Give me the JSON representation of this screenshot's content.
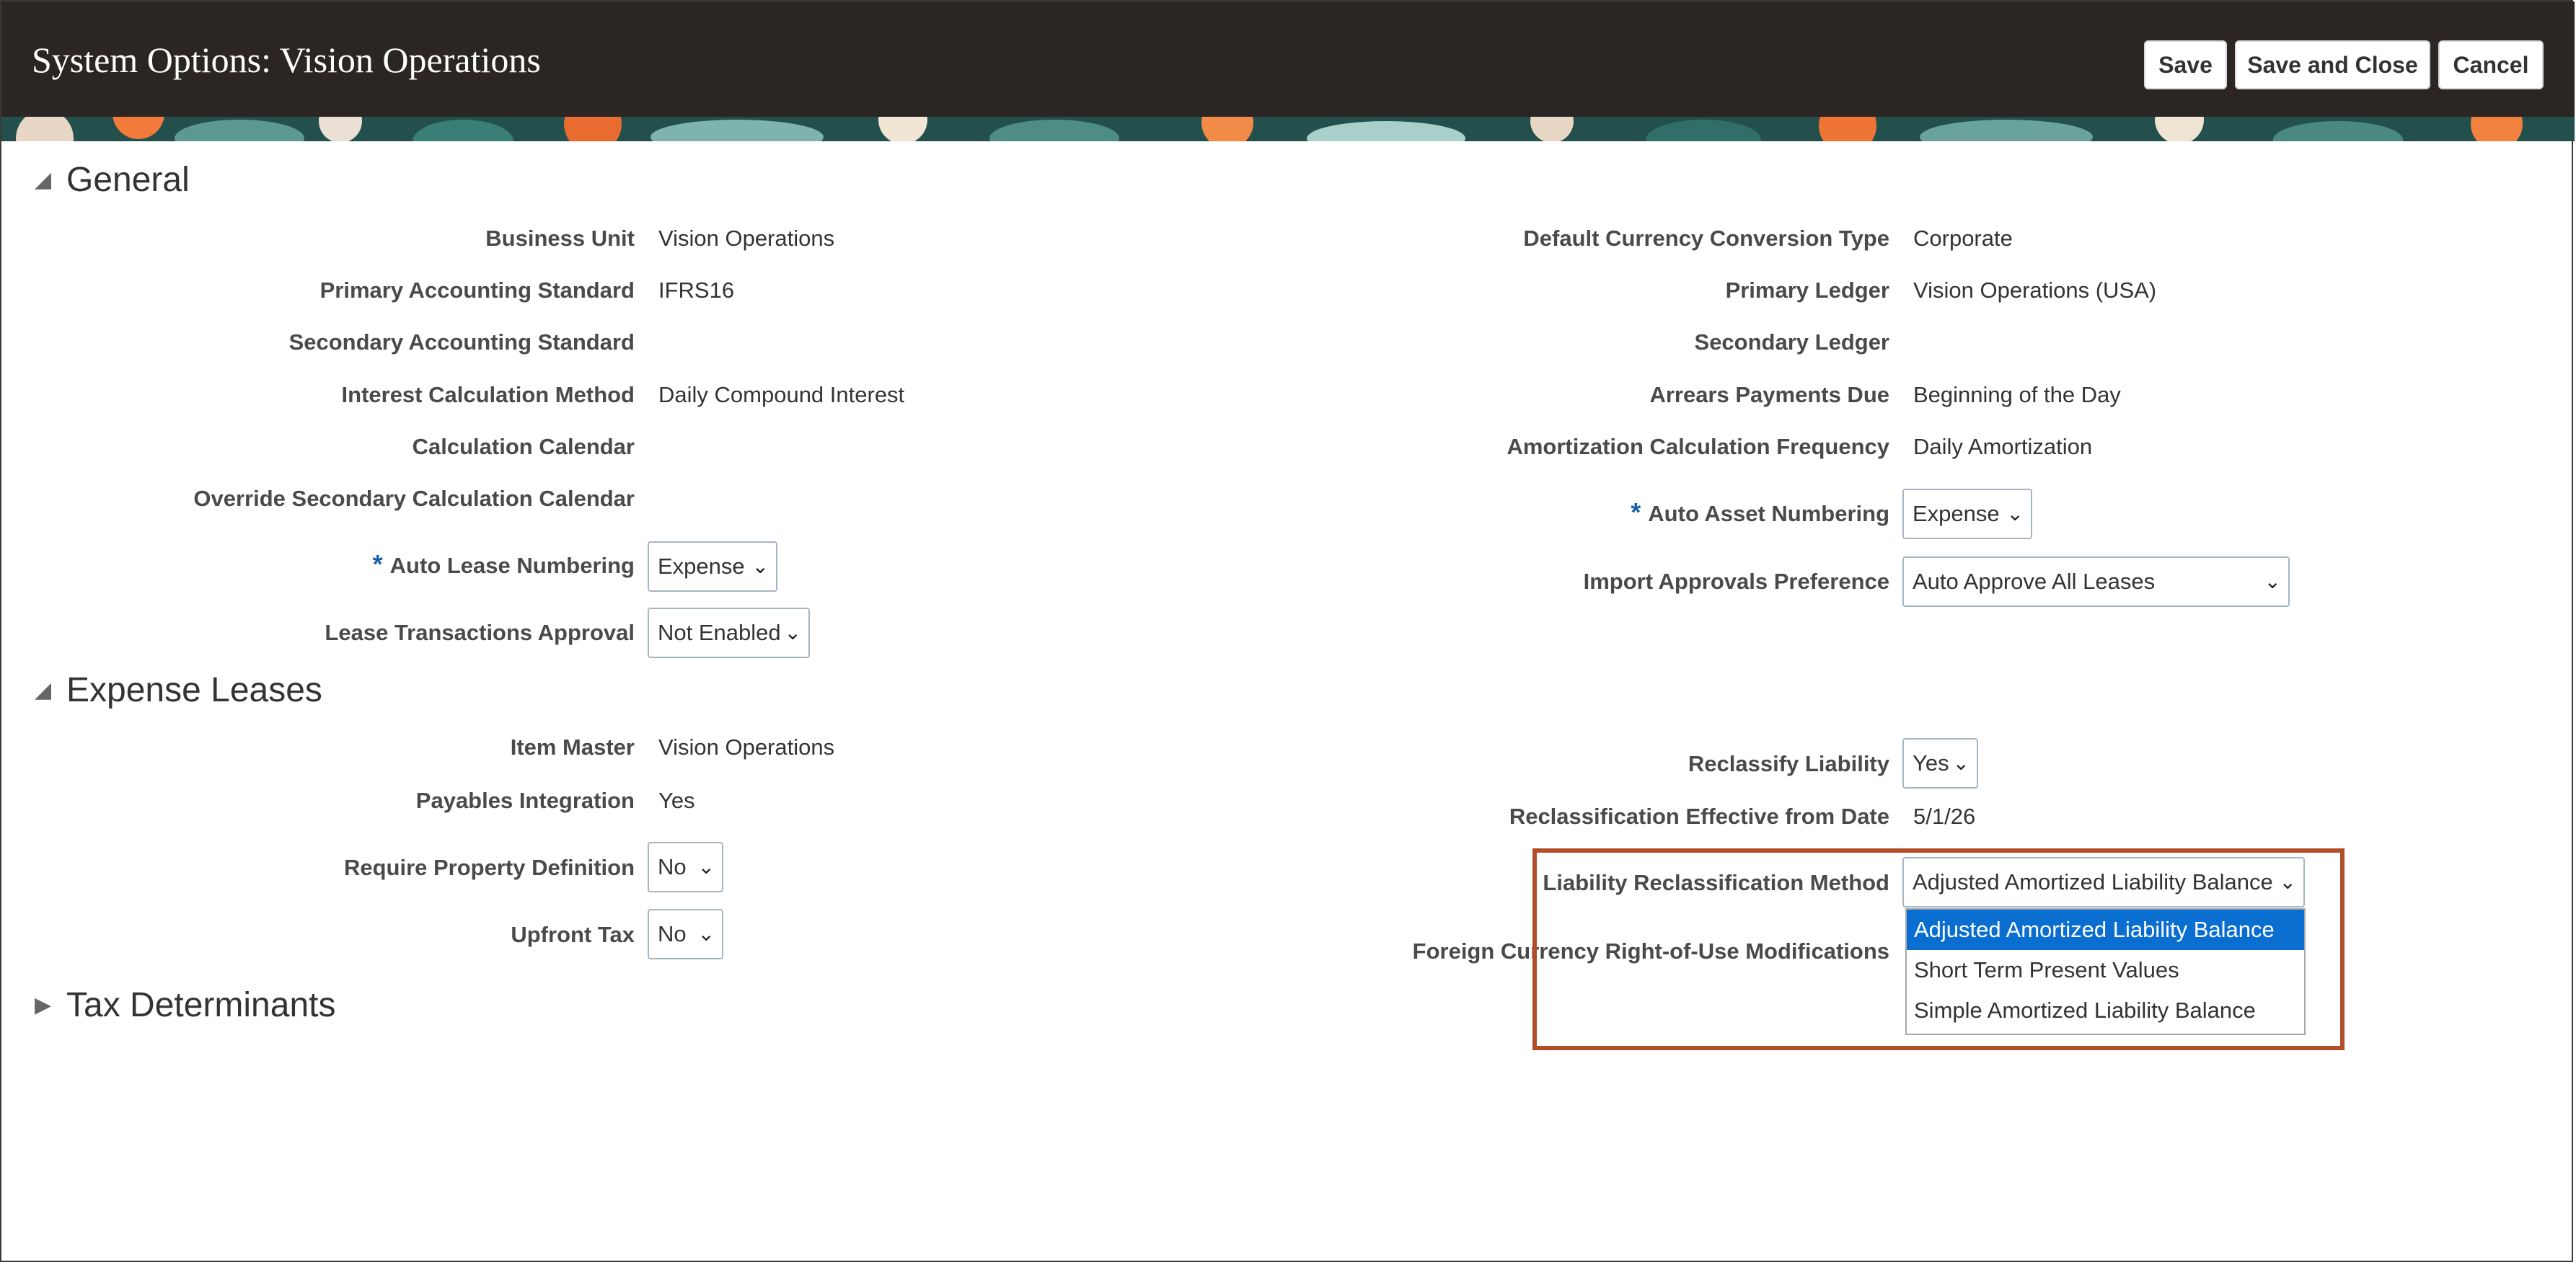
{
  "header": {
    "title": "System Options: Vision Operations",
    "buttons": {
      "save": "Save",
      "save_and_close": "Save and Close",
      "cancel": "Cancel"
    }
  },
  "general": {
    "title": "General",
    "left": {
      "business_unit": {
        "label": "Business Unit",
        "value": "Vision Operations"
      },
      "primary_accounting_standard": {
        "label": "Primary Accounting Standard",
        "value": "IFRS16"
      },
      "secondary_accounting_standard": {
        "label": "Secondary Accounting Standard",
        "value": ""
      },
      "interest_calculation_method": {
        "label": "Interest Calculation Method",
        "value": "Daily Compound Interest"
      },
      "calculation_calendar": {
        "label": "Calculation Calendar",
        "value": ""
      },
      "override_secondary_calendar": {
        "label": "Override Secondary Calculation Calendar",
        "value": ""
      },
      "auto_lease_numbering": {
        "label": "Auto Lease Numbering",
        "value": "Expense",
        "required": "*"
      },
      "lease_transactions_approval": {
        "label": "Lease Transactions Approval",
        "value": "Not Enabled"
      }
    },
    "right": {
      "default_currency_conversion_type": {
        "label": "Default Currency Conversion Type",
        "value": "Corporate"
      },
      "primary_ledger": {
        "label": "Primary Ledger",
        "value": "Vision Operations (USA)"
      },
      "secondary_ledger": {
        "label": "Secondary Ledger",
        "value": ""
      },
      "arrears_payments_due": {
        "label": "Arrears Payments Due",
        "value": "Beginning of the Day"
      },
      "amortization_calculation_frequency": {
        "label": "Amortization Calculation Frequency",
        "value": "Daily Amortization"
      },
      "auto_asset_numbering": {
        "label": "Auto Asset Numbering",
        "value": "Expense",
        "required": "*"
      },
      "import_approvals_preference": {
        "label": "Import Approvals Preference",
        "value": "Auto Approve All Leases"
      }
    }
  },
  "expense_leases": {
    "title": "Expense Leases",
    "left": {
      "item_master": {
        "label": "Item Master",
        "value": "Vision Operations"
      },
      "payables_integration": {
        "label": "Payables Integration",
        "value": "Yes"
      },
      "require_property_definition": {
        "label": "Require Property Definition",
        "value": "No"
      },
      "upfront_tax": {
        "label": "Upfront Tax",
        "value": "No"
      }
    },
    "right": {
      "reclassify_liability": {
        "label": "Reclassify Liability",
        "value": "Yes"
      },
      "reclassification_effective_from_date": {
        "label": "Reclassification Effective from Date",
        "value": "5/1/26"
      },
      "liability_reclassification_method": {
        "label": "Liability Reclassification Method",
        "value": "Adjusted Amortized Liability Balance",
        "options": [
          "Adjusted Amortized Liability Balance",
          "Short Term Present Values",
          "Simple Amortized Liability Balance"
        ]
      },
      "foreign_currency_rou_modifications": {
        "label": "Foreign Currency Right-of-Use Modifications"
      }
    }
  },
  "tax_determinants": {
    "title": "Tax Determinants"
  },
  "icons": {
    "collapse": "triangle-down-icon",
    "expand": "triangle-right-icon",
    "dropdown": "chevron-down-icon"
  },
  "colors": {
    "header_bg": "#2b2623",
    "selected_option": "#0a6ed1",
    "highlight_box": "#b24d2a"
  }
}
